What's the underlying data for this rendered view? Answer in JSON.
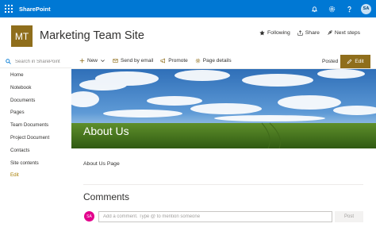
{
  "suite_bar": {
    "title": "SharePoint",
    "avatar_initials": "SA",
    "icons": [
      "waffle-icon",
      "bell-icon",
      "gear-icon",
      "help-icon"
    ],
    "accent_color": "#0078d4"
  },
  "site": {
    "logo_initials": "MT",
    "logo_color": "#8f6e1c",
    "title": "Marketing Team Site",
    "actions": {
      "following": "Following",
      "share": "Share",
      "next_steps": "Next steps"
    }
  },
  "search": {
    "placeholder": "Search in SharePoint"
  },
  "nav": {
    "items": [
      {
        "label": "Home"
      },
      {
        "label": "Notebook"
      },
      {
        "label": "Documents"
      },
      {
        "label": "Pages"
      },
      {
        "label": "Team Documents"
      },
      {
        "label": "Project Document"
      },
      {
        "label": "Contacts"
      },
      {
        "label": "Site contents"
      },
      {
        "label": "Edit"
      }
    ]
  },
  "command_bar": {
    "new": "New",
    "send_by_email": "Send by email",
    "promote": "Promote",
    "page_details": "Page details",
    "status": "Posted",
    "edit": "Edit"
  },
  "hero": {
    "title": "About Us"
  },
  "content": {
    "page_text": "About Us Page",
    "comments_title": "Comments",
    "comment_avatar_initials": "SA",
    "comment_placeholder": "Add a comment. Type @ to mention someone",
    "post_label": "Post"
  }
}
